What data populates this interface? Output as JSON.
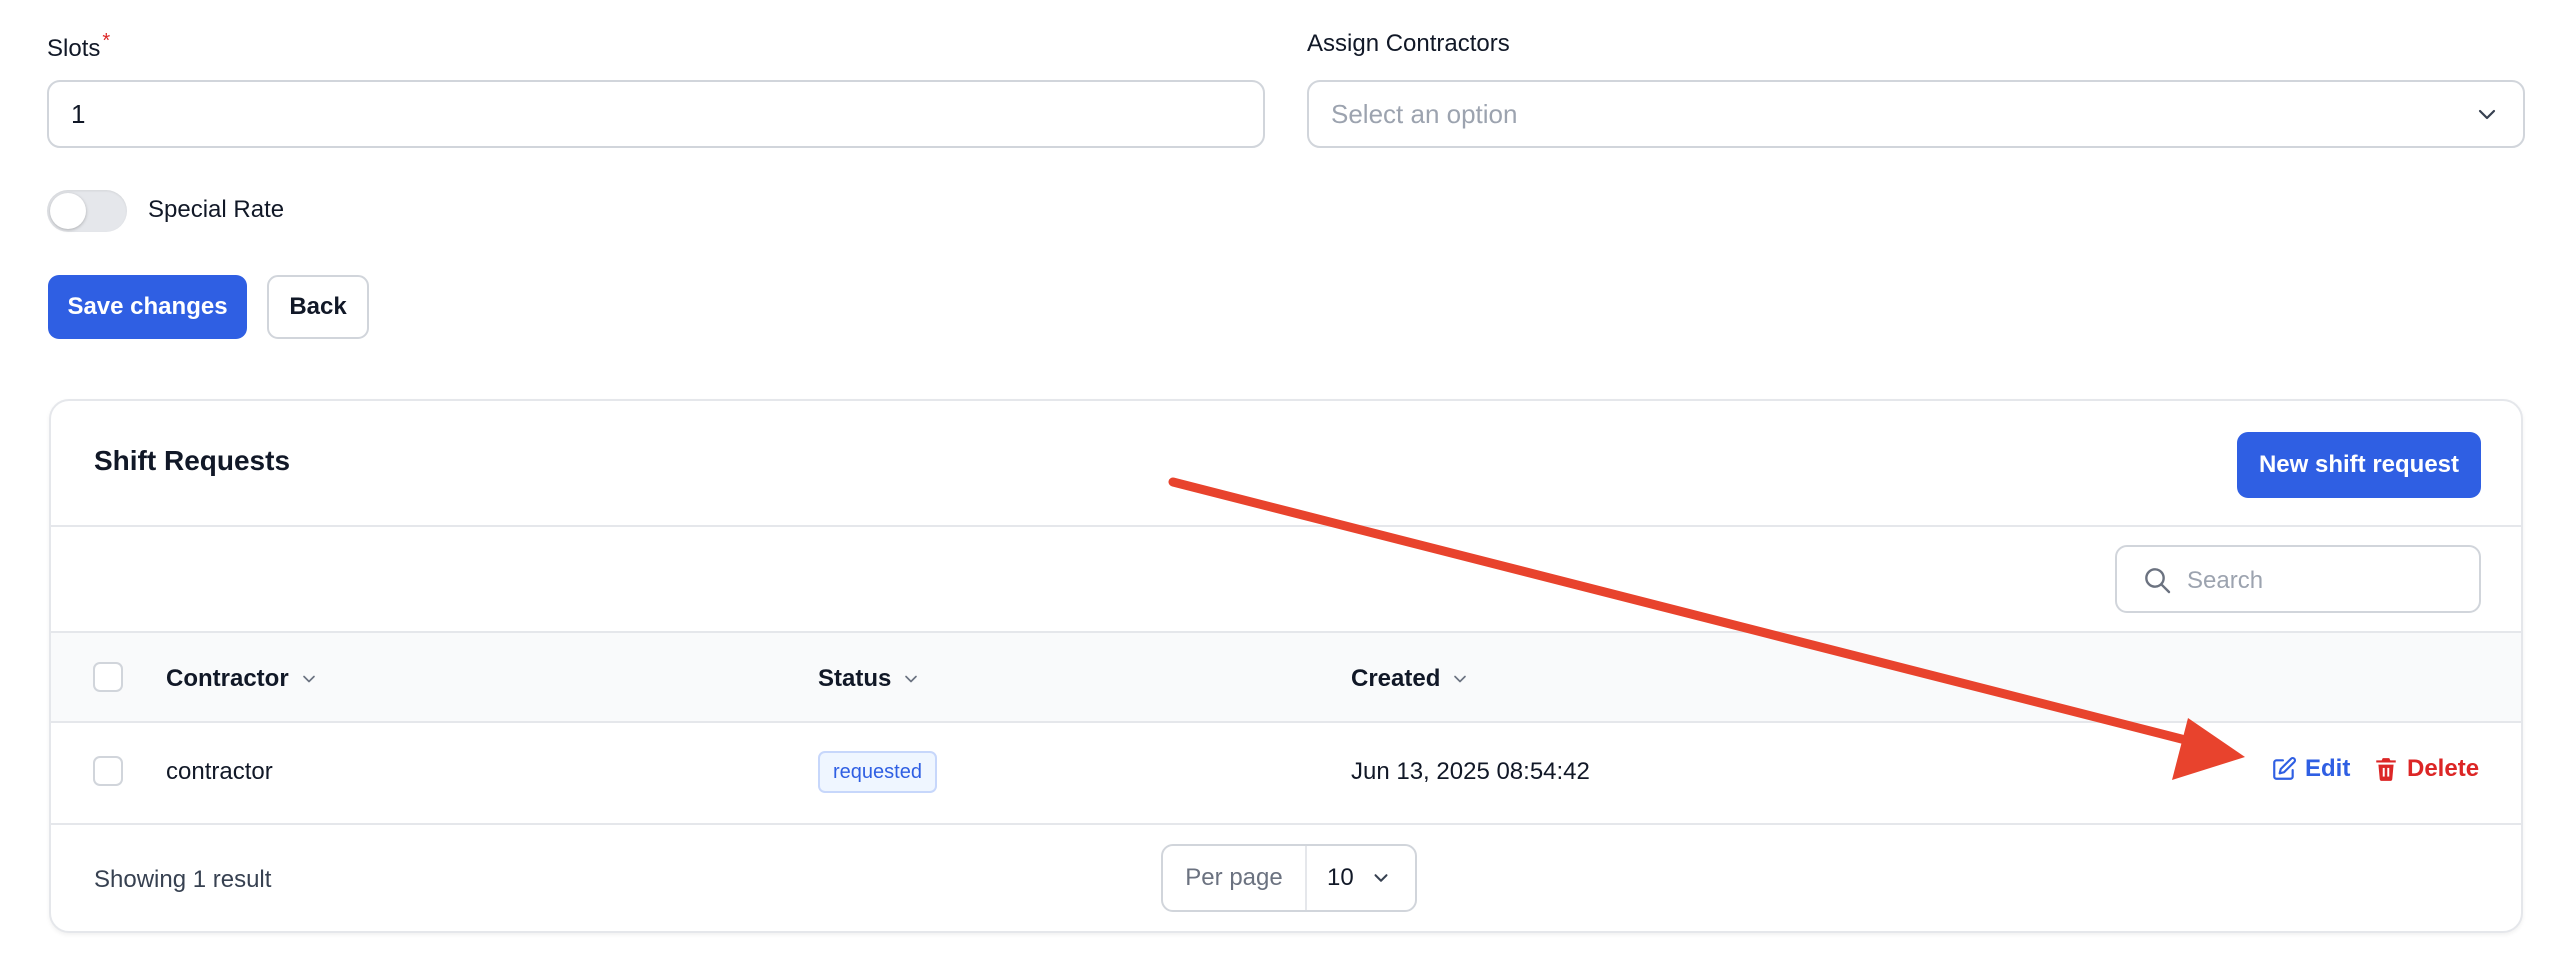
{
  "form": {
    "slots_label": "Slots",
    "slots_required_mark": "*",
    "slots_value": "1",
    "contractors_label": "Assign Contractors",
    "contractors_placeholder": "Select an option",
    "special_rate_label": "Special Rate",
    "special_rate_on": false,
    "save_label": "Save changes",
    "back_label": "Back"
  },
  "shift_requests": {
    "title": "Shift Requests",
    "new_button_label": "New shift request",
    "search_placeholder": "Search",
    "columns": [
      "Contractor",
      "Status",
      "Created"
    ],
    "rows": [
      {
        "contractor": "contractor",
        "status": "requested",
        "created": "Jun 13, 2025 08:54:42",
        "edit_label": "Edit",
        "delete_label": "Delete"
      }
    ],
    "footer": {
      "showing": "Showing 1 result",
      "per_page_label": "Per page",
      "per_page_value": "10"
    }
  },
  "colors": {
    "primary": "#2f5fe3",
    "danger": "#dc2626",
    "annotation_arrow": "#e8432d"
  },
  "icons": {
    "select_chevron": "chevron-down-icon",
    "sort": "chevron-down-icon",
    "search": "search-icon",
    "edit": "pencil-square-icon",
    "delete": "trash-icon"
  }
}
